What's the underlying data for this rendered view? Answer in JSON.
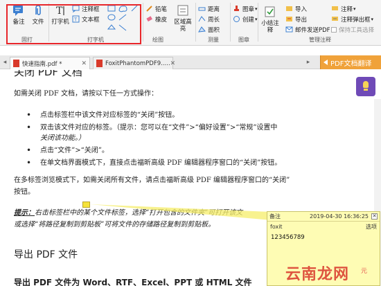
{
  "ribbon": {
    "groups": {
      "pin": "固打",
      "typewriter": "打字机",
      "drawing": "绘图",
      "measure": "测量",
      "stamp": "图章",
      "manage": "管理注释"
    },
    "buttons": {
      "note": "备注",
      "file": "文件",
      "typewriter": "打字机",
      "callout": "注释框",
      "textbox": "文本框",
      "pencil": "铅笔",
      "eraser": "橡皮",
      "area_highlight": "区域高亮",
      "distance": "距离",
      "perimeter": "周长",
      "area": "面积",
      "stamp": "图章",
      "create": "创建",
      "summarize": "小结注释",
      "import": "导入",
      "export": "导出",
      "email_pdf": "邮件发送PDF",
      "comment": "注释",
      "comment_popup": "注释弹出框",
      "keep_tool": "保持工具选择"
    }
  },
  "tabs": [
    {
      "label": "快速指南.pdf *"
    },
    {
      "label": "FoxitPhantomPDF9....."
    }
  ],
  "translate_button": "PDF文档翻译",
  "document": {
    "heading_cut": "关闭 PDF 文档",
    "intro": "如需关闭 PDF 文档，请按以下任一方式操作：",
    "bullets": [
      "点击标签栏中该文件对应标签的“关闭”按钮。",
      "双击该文件对应的标签。（提示：您可以在“文件”>“偏好设置”>“常规”设置中",
      "关闭该功能。）",
      "点击“文件”>“关闭”。",
      "在单文档界面模式下，直接点击福昕高级 PDF 编辑器程序窗口的“关闭”按钮。"
    ],
    "multi_tab_1": "在多标签浏览模式下，如需关闭所有文件，请点击福昕高级 PDF 编辑器程序窗口的“关闭”",
    "multi_tab_2": "按钮。",
    "tip_label": "提示：",
    "tip_line1": "右击标签栏中的某个文件标签，选择“打开包含的文件夹”可打开该文",
    "tip_line2": "或选择“将路径复制到剪贴板”可将文件的存储路径复制到剪贴板。",
    "export_heading": "导出 PDF 文件",
    "export_sub": "导出 PDF 文件为 Word、RTF、Excel、PPT 或 HTML 文件"
  },
  "note_popup": {
    "title": "备注",
    "datetime": "2019-04-30 16:36:25",
    "author": "foxit",
    "options": "选项",
    "content": "123456789"
  },
  "watermark": "云南龙网",
  "watermark_small": "元",
  "colors": {
    "highlight_border": "#e8262a",
    "translate_bg": "#f0a23a",
    "note_bg": "#fefcb4",
    "watermark": "#d9372b"
  }
}
